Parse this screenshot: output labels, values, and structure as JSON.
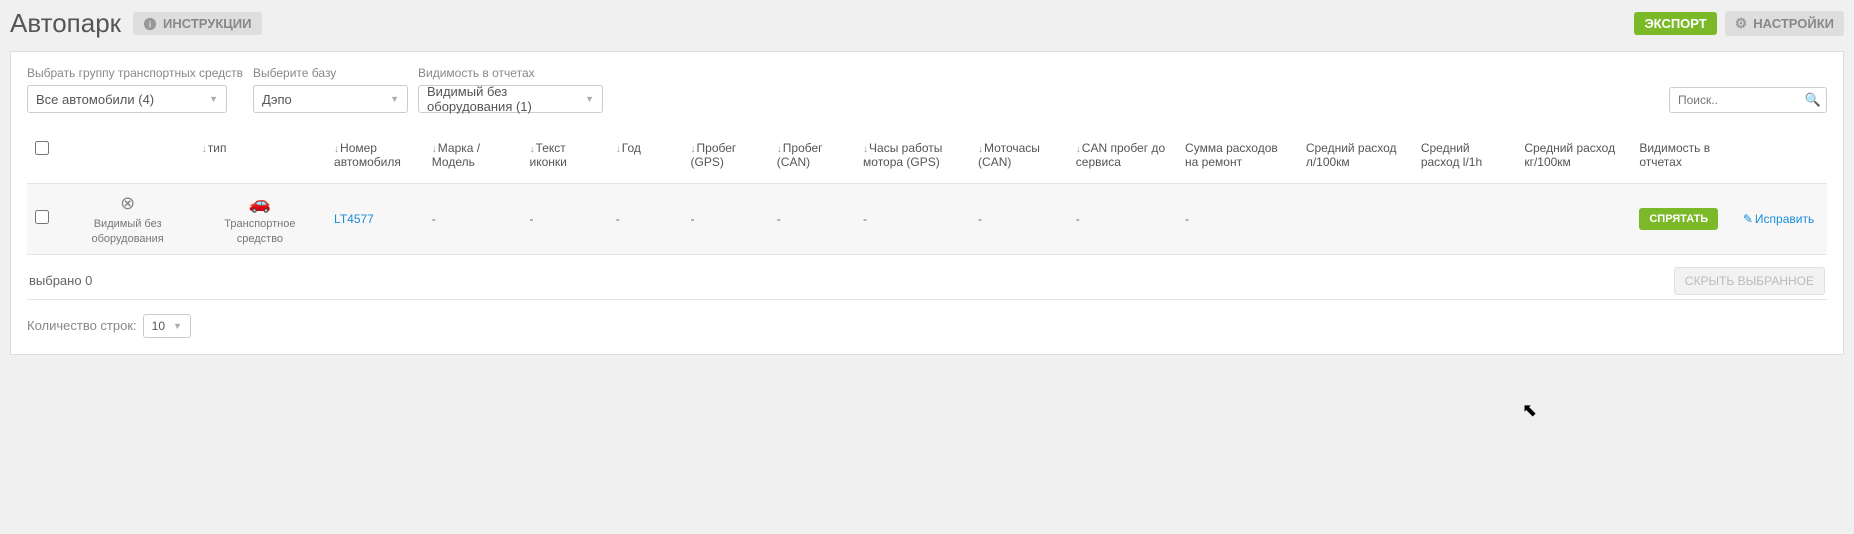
{
  "header": {
    "title": "Автопарк",
    "instructions": "ИНСТРУКЦИИ",
    "export": "ЭКСПОРТ",
    "settings": "НАСТРОЙКИ"
  },
  "filters": {
    "group_label": "Выбрать группу транспортных средств",
    "group_value": "Все автомобили   (4)",
    "base_label": "Выберите базу",
    "base_value": "Дэпо",
    "visibility_label": "Видимость в отчетах",
    "visibility_value": "Видимый без оборудования (1)"
  },
  "search": {
    "placeholder": "Поиск.."
  },
  "columns": {
    "type": "тип",
    "number": "Номер автомобиля",
    "make": "Марка / Модель",
    "icon_text": "Текст иконки",
    "year": "Год",
    "mileage_gps": "Пробег (GPS)",
    "mileage_can": "Пробег (CAN)",
    "engine_hours_gps": "Часы работы мотора (GPS)",
    "engine_hours_can": "Моточасы (CAN)",
    "can_to_service": "CAN пробег до сервиса",
    "repair_cost": "Сумма расходов на ремонт",
    "avg_l100": "Средний расход л/100км",
    "avg_l1h": "Средний расход l/1h",
    "avg_kg100": "Средний расход кг/100км",
    "report_visibility": "Видимость в отчетах"
  },
  "rows": [
    {
      "status_label": "Видимый без оборудования",
      "type_label": "Транспортное средство",
      "number": "LT4577",
      "make": "-",
      "icon_text": "-",
      "year": "-",
      "mileage_gps": "-",
      "mileage_can": "-",
      "engine_hours_gps": "-",
      "engine_hours_can": "-",
      "can_to_service": "-",
      "repair_cost": "-",
      "hide_label": "СПРЯТАТЬ",
      "edit_label": "Исправить"
    }
  ],
  "footer": {
    "selected": "выбрано 0",
    "hide_selected": "СКРЫТЬ ВЫБРАННОЕ",
    "rows_label": "Количество строк:",
    "rows_value": "10"
  }
}
